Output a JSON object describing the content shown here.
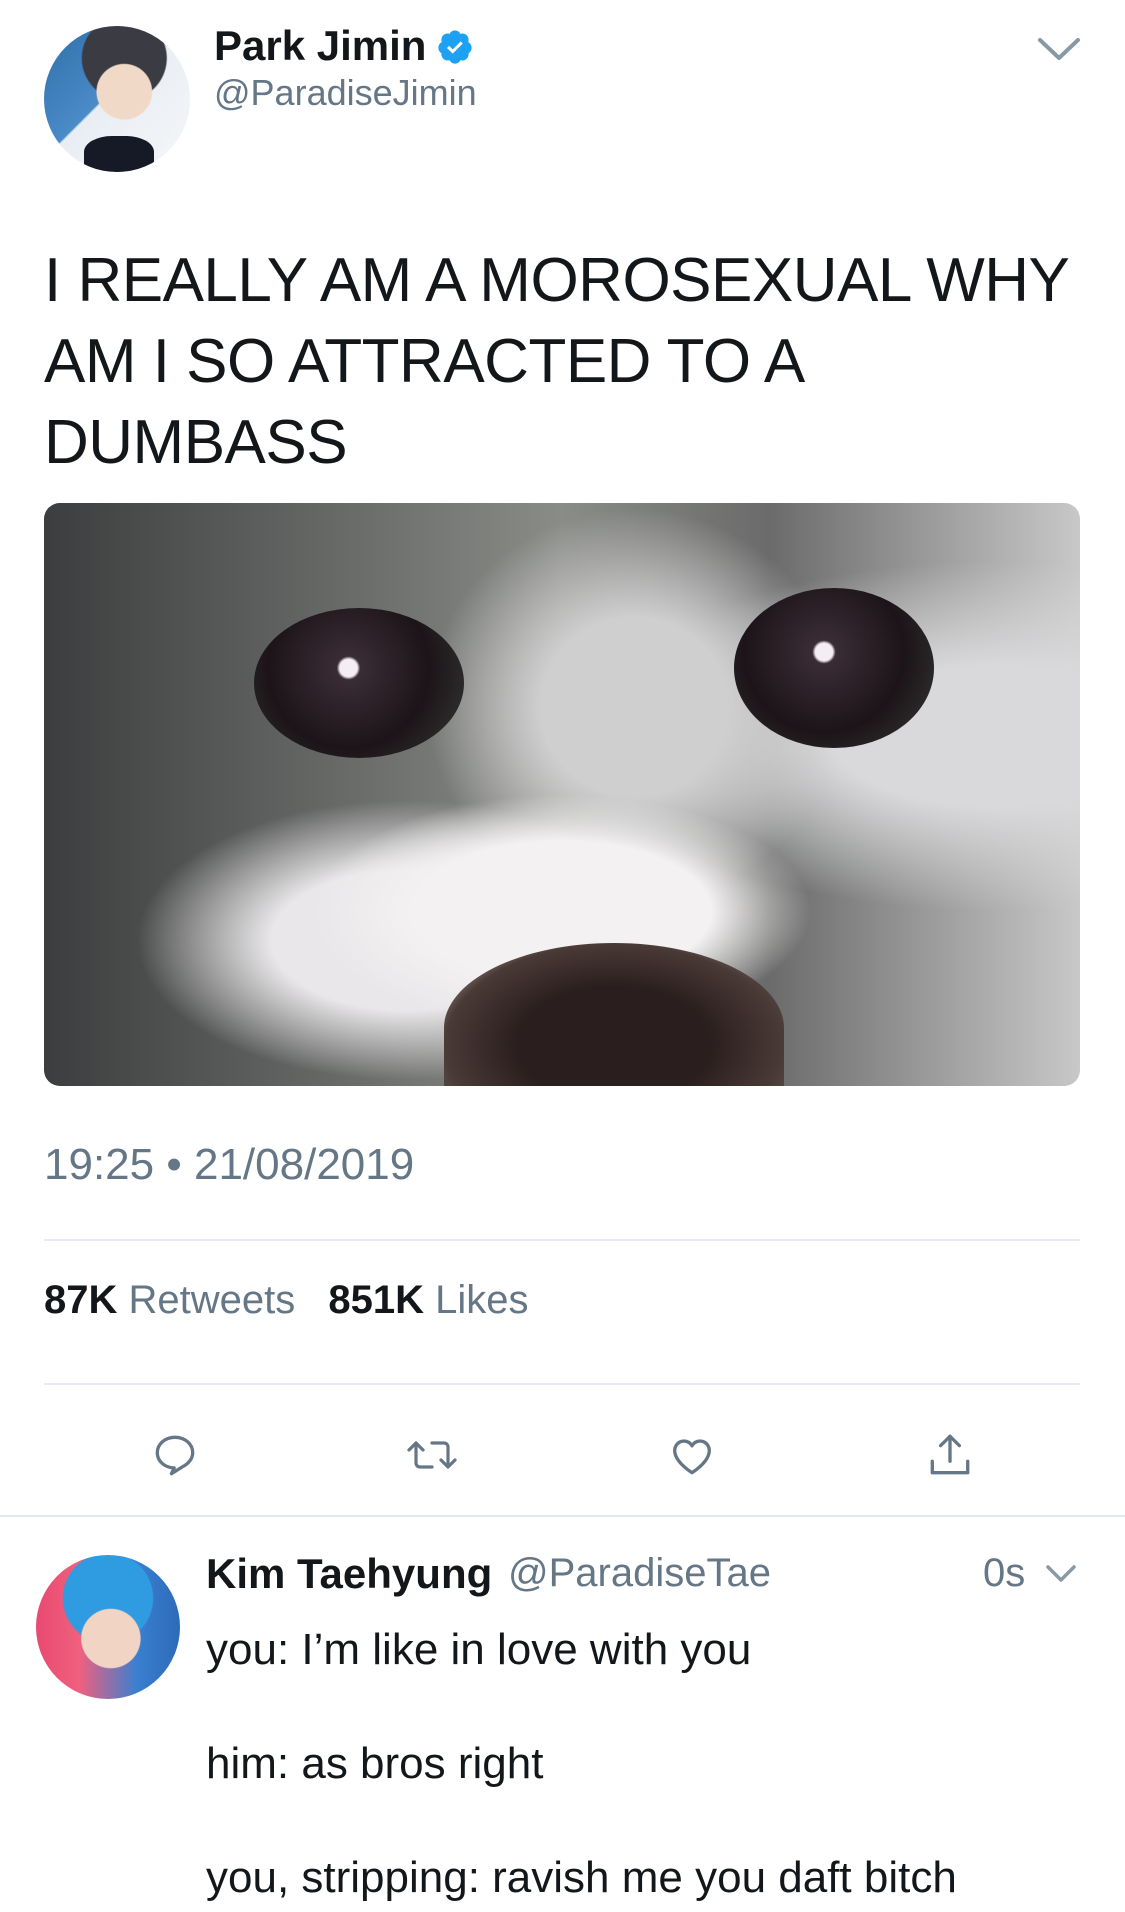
{
  "main_tweet": {
    "author_name": "Park Jimin",
    "author_handle": "@ParadiseJimin",
    "verified": true,
    "text": "I REALLY AM A MOROSEXUAL WHY AM I SO ATTRACTED TO A DUMBASS",
    "media_description_icon": "crying-cat-image",
    "time": "19:25",
    "separator": "•",
    "date": "21/08/2019",
    "retweets_count": "87K",
    "retweets_label": "Retweets",
    "likes_count": "851K",
    "likes_label": "Likes",
    "actions": [
      "reply-icon",
      "retweet-icon",
      "like-icon",
      "share-icon"
    ]
  },
  "reply_tweet": {
    "author_name": "Kim Taehyung",
    "author_handle": "@ParadiseTae",
    "time": "0s",
    "lines": [
      "you: I’m like in love with you",
      "him: as bros right",
      "you, stripping: ravish me you daft bitch"
    ]
  },
  "colors": {
    "text_primary": "#14171a",
    "text_secondary": "#657786",
    "verified_blue": "#1da1f2",
    "divider": "#e6ecf0"
  }
}
